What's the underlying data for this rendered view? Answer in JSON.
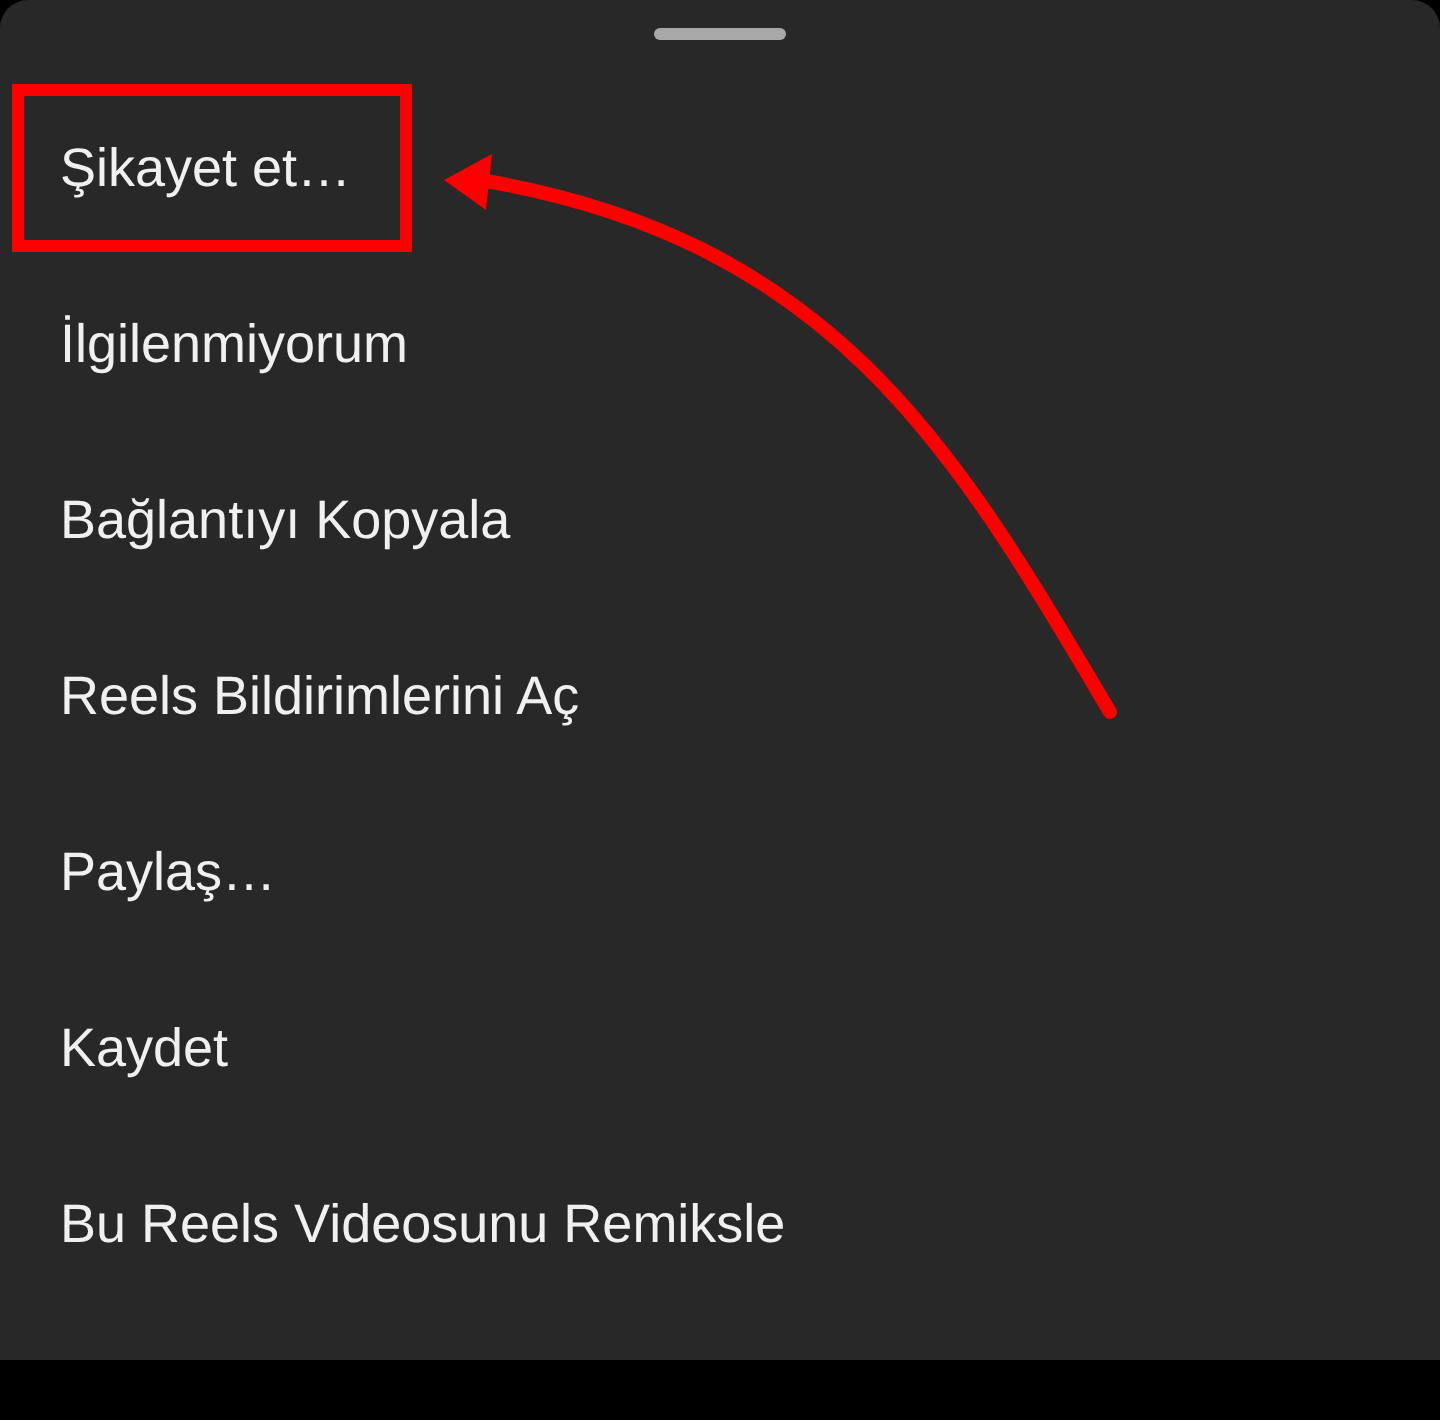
{
  "menu": {
    "items": [
      {
        "label": "Şikayet et…",
        "highlighted": true
      },
      {
        "label": "İlgilenmiyorum",
        "highlighted": false
      },
      {
        "label": "Bağlantıyı Kopyala",
        "highlighted": false
      },
      {
        "label": "Reels Bildirimlerini Aç",
        "highlighted": false
      },
      {
        "label": "Paylaş…",
        "highlighted": false
      },
      {
        "label": "Kaydet",
        "highlighted": false
      },
      {
        "label": "Bu Reels Videosunu Remiksle",
        "highlighted": false
      }
    ]
  }
}
